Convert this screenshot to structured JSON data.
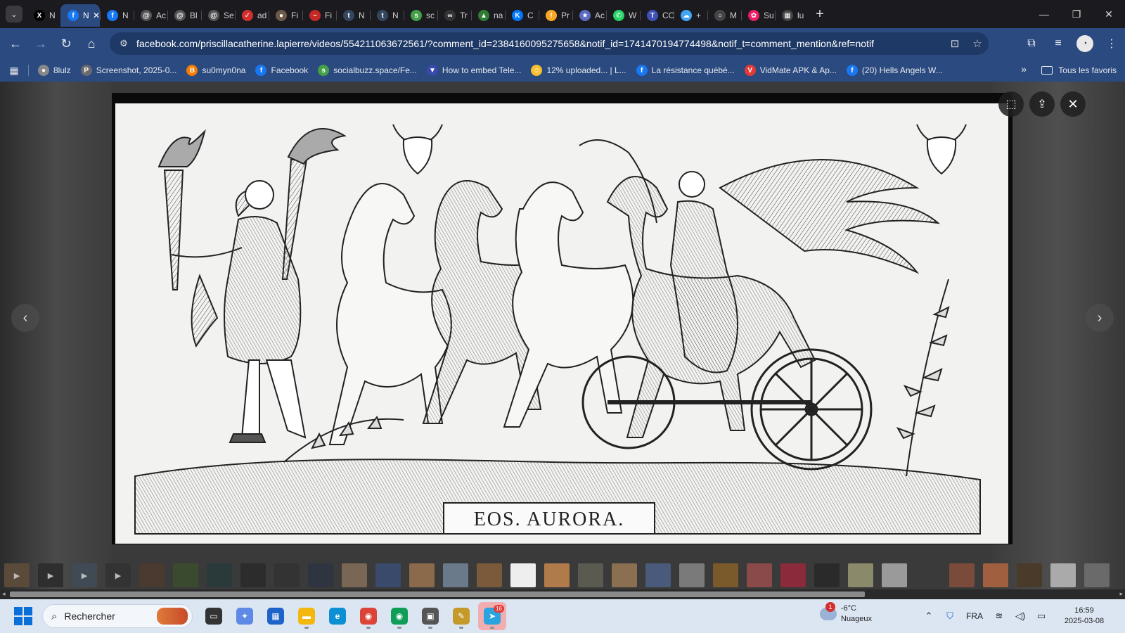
{
  "tabs": [
    {
      "label": "N",
      "icon": "x-icon",
      "color": "#000000",
      "glyph": "X"
    },
    {
      "label": "N",
      "icon": "facebook-icon",
      "color": "#1877f2",
      "glyph": "f",
      "active": true
    },
    {
      "label": "N",
      "icon": "facebook-icon",
      "color": "#1877f2",
      "glyph": "f"
    },
    {
      "label": "Ac",
      "icon": "threads-icon",
      "color": "#555555",
      "glyph": "@"
    },
    {
      "label": "Bl",
      "icon": "threads-icon",
      "color": "#555555",
      "glyph": "@"
    },
    {
      "label": "Se",
      "icon": "threads-icon",
      "color": "#555555",
      "glyph": "@"
    },
    {
      "label": "ad",
      "icon": "shield-icon",
      "color": "#d32f2f",
      "glyph": "✓"
    },
    {
      "label": "Fi",
      "icon": "globe-icon",
      "color": "#6d5a4a",
      "glyph": "●"
    },
    {
      "label": "Fi",
      "icon": "swoosh-icon",
      "color": "#c62828",
      "glyph": "~"
    },
    {
      "label": "N",
      "icon": "tumblr-icon",
      "color": "#34465d",
      "glyph": "t"
    },
    {
      "label": "N",
      "icon": "tumblr-icon",
      "color": "#34465d",
      "glyph": "t"
    },
    {
      "label": "sc",
      "icon": "socialbuzz-icon",
      "color": "#43a047",
      "glyph": "s"
    },
    {
      "label": "Tr",
      "icon": "chat-icon",
      "color": "#333333",
      "glyph": "∞"
    },
    {
      "label": "na",
      "icon": "image-icon",
      "color": "#2e7d32",
      "glyph": "▲"
    },
    {
      "label": "C",
      "icon": "vk-icon",
      "color": "#0077ff",
      "glyph": "K"
    },
    {
      "label": "Pr",
      "icon": "bolt-icon",
      "color": "#f9a825",
      "glyph": "!"
    },
    {
      "label": "Ac",
      "icon": "star-icon",
      "color": "#5c6bc0",
      "glyph": "★"
    },
    {
      "label": "W",
      "icon": "whatsapp-icon",
      "color": "#25d366",
      "glyph": "✆"
    },
    {
      "label": "CC",
      "icon": "t-icon",
      "color": "#3f51b5",
      "glyph": "T"
    },
    {
      "label": "+",
      "icon": "cloud-icon",
      "color": "#42a5f5",
      "glyph": "☁"
    },
    {
      "label": "M",
      "icon": "circle-icon",
      "color": "#444444",
      "glyph": "○"
    },
    {
      "label": "Su",
      "icon": "art-icon",
      "color": "#e91e63",
      "glyph": "✿"
    },
    {
      "label": "lu",
      "icon": "grid-icon",
      "color": "#444444",
      "glyph": "▦"
    }
  ],
  "url": "facebook.com/priscillacatherine.lapierre/videos/554211063672561/?comment_id=2384160095275658&notif_id=1741470194774498&notif_t=comment_mention&ref=notif",
  "bookmarks": [
    {
      "label": "8lulz",
      "icon": "globe-icon",
      "color": "#888888",
      "glyph": "●"
    },
    {
      "label": "Screenshot, 2025-0...",
      "icon": "p-icon",
      "color": "#6b6b6b",
      "glyph": "P"
    },
    {
      "label": "su0myn0na",
      "icon": "blogger-icon",
      "color": "#f57c00",
      "glyph": "B"
    },
    {
      "label": "Facebook",
      "icon": "facebook-icon",
      "color": "#1877f2",
      "glyph": "f"
    },
    {
      "label": "socialbuzz.space/Fe...",
      "icon": "socialbuzz-icon",
      "color": "#43a047",
      "glyph": "s"
    },
    {
      "label": "How to embed Tele...",
      "icon": "boat-icon",
      "color": "#3949ab",
      "glyph": "▼"
    },
    {
      "label": "12% uploaded... | L...",
      "icon": "emoji-icon",
      "color": "#fbc02d",
      "glyph": "☺"
    },
    {
      "label": "La résistance québé...",
      "icon": "facebook-icon",
      "color": "#1877f2",
      "glyph": "f"
    },
    {
      "label": "VidMate APK & Ap...",
      "icon": "vidmate-icon",
      "color": "#e53935",
      "glyph": "V"
    },
    {
      "label": "(20) Hells Angels W...",
      "icon": "facebook-icon",
      "color": "#1877f2",
      "glyph": "f"
    }
  ],
  "bookmarks_folder": "Tous les favoris",
  "image_caption": "EOS.    AURORA.",
  "thumbnails": [
    {
      "bg": "#5a4a3a",
      "play": true
    },
    {
      "bg": "#2e2e2e",
      "play": true
    },
    {
      "bg": "#3f4a55",
      "play": true
    },
    {
      "bg": "#333333",
      "play": true
    },
    {
      "bg": "#4a3a30"
    },
    {
      "bg": "#3a4a2e"
    },
    {
      "bg": "#2a3a3a"
    },
    {
      "bg": "#2c2c2c"
    },
    {
      "bg": "#333333"
    },
    {
      "bg": "#2e3440"
    },
    {
      "bg": "#7a6655"
    },
    {
      "bg": "#3a4a6a"
    },
    {
      "bg": "#8a6a4a"
    },
    {
      "bg": "#6a7a8a"
    },
    {
      "bg": "#7a5a3a"
    },
    {
      "bg": "#eeeeee"
    },
    {
      "bg": "#b07a4a"
    },
    {
      "bg": "#5a5a50"
    },
    {
      "bg": "#8a7050"
    },
    {
      "bg": "#4a5a7a"
    },
    {
      "bg": "#7a7a7a"
    },
    {
      "bg": "#7a5a2a"
    },
    {
      "bg": "#8a4a4a"
    },
    {
      "bg": "#8a2a3a"
    },
    {
      "bg": "#2a2a2a"
    },
    {
      "bg": "#8a8a6a"
    },
    {
      "bg": "#9a9a9a"
    },
    {
      "bg": "#3a3a3a"
    },
    {
      "bg": "#7a4a3a"
    },
    {
      "bg": "#a06040"
    },
    {
      "bg": "#4a3a2a"
    },
    {
      "bg": "#aaaaaa"
    },
    {
      "bg": "#6a6a6a"
    }
  ],
  "taskbar": {
    "search_placeholder": "Rechercher",
    "apps": [
      {
        "name": "task-view",
        "color": "#333333",
        "glyph": "▭"
      },
      {
        "name": "copilot",
        "color": "#5e8ae6",
        "glyph": "✦"
      },
      {
        "name": "store",
        "color": "#1e63c9",
        "glyph": "▦"
      },
      {
        "name": "file-explorer",
        "color": "#f2b80f",
        "glyph": "▬",
        "running": true
      },
      {
        "name": "edge",
        "color": "#0c8fd3",
        "glyph": "e"
      },
      {
        "name": "chrome",
        "color": "#db4437",
        "glyph": "◉",
        "running": true
      },
      {
        "name": "chrome-profile",
        "color": "#0f9d58",
        "glyph": "◉",
        "running": true
      },
      {
        "name": "screen-tool",
        "color": "#555555",
        "glyph": "▣",
        "running": true
      },
      {
        "name": "pencil-app",
        "color": "#c49a2a",
        "glyph": "✎",
        "running": true
      },
      {
        "name": "telegram",
        "color": "#2aa3df",
        "glyph": "➤",
        "running": true,
        "badge": "16",
        "highlight": true
      }
    ],
    "weather": {
      "badge": "1",
      "temp": "-6°C",
      "condition": "Nuageux"
    },
    "language": "FRA",
    "time": "16:59",
    "date": "2025-03-08"
  }
}
